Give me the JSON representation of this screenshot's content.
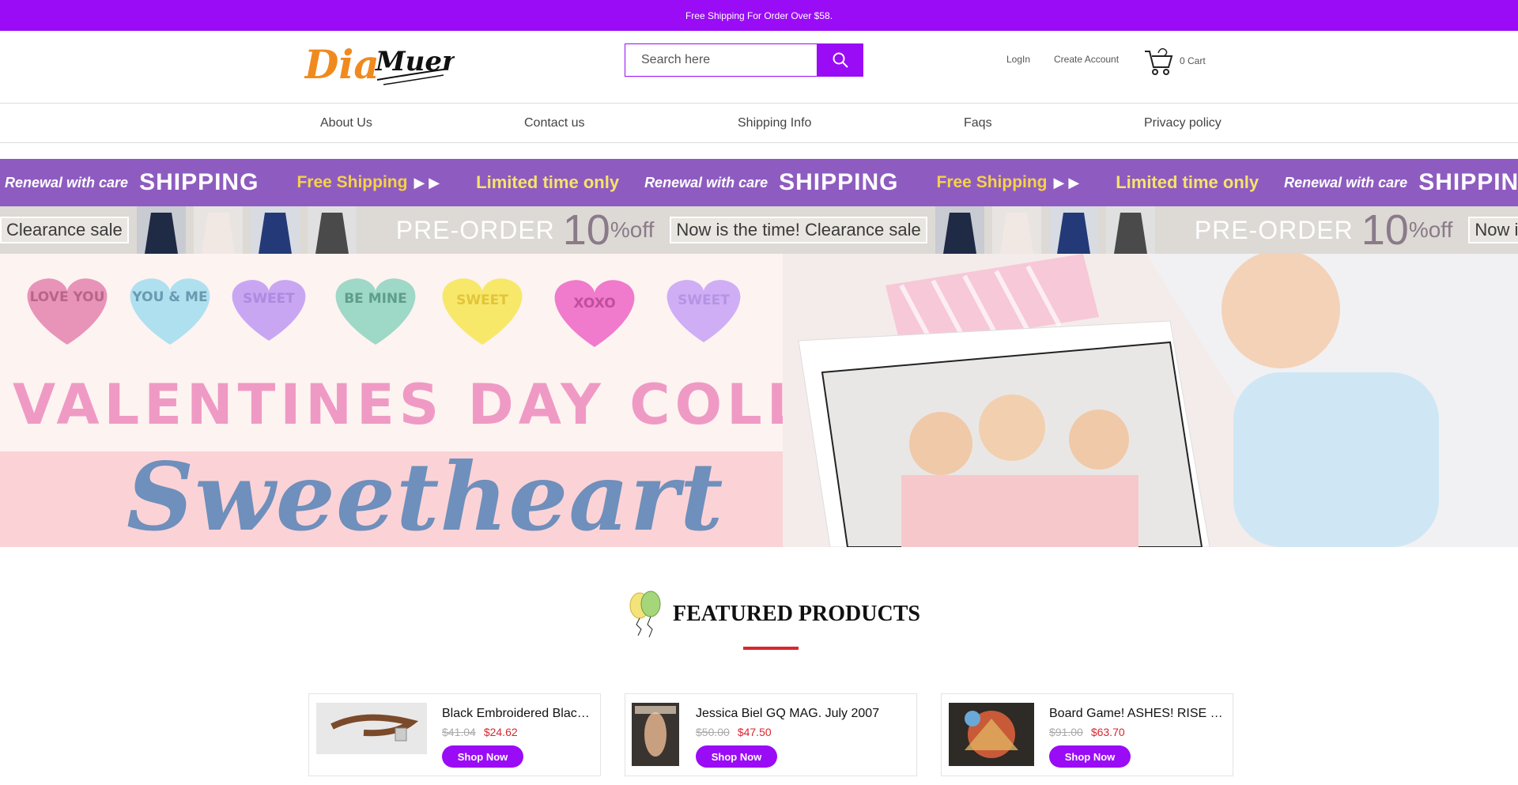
{
  "topbar": {
    "text": "Free Shipping For Order Over $58."
  },
  "header": {
    "logo_text_1": "Dia",
    "logo_text_2": "Muertos",
    "search_placeholder": "Search here",
    "login_label": "LogIn",
    "create_account_label": "Create Account",
    "cart_label": "0 Cart"
  },
  "nav": {
    "items": [
      {
        "label": "About Us"
      },
      {
        "label": "Contact us"
      },
      {
        "label": "Shipping Info"
      },
      {
        "label": "Faqs"
      },
      {
        "label": "Privacy policy"
      }
    ]
  },
  "promo_strip_1": {
    "renewal": "Renewal with care",
    "shipping": "SHIPPING",
    "free_shipping": "Free Shipping",
    "arrows": "▶ ▶",
    "limited": "Limited time only"
  },
  "promo_strip_2": {
    "clearance": "Clearance sale",
    "pre_order": "PRE-ORDER",
    "ten": "10",
    "percent_off": "%off",
    "now": "Now is the time! Clearance sale",
    "now_partial": "Now is the t"
  },
  "hero": {
    "hearts": [
      "LOVE YOU",
      "YOU & ME",
      "SWEET",
      "BE MINE",
      "SWEET",
      "XOXO",
      "SWEET"
    ],
    "title": "VALENTINES DAY COLLECTION",
    "script": "Sweetheart"
  },
  "featured": {
    "title": "FEATURED PRODUCTS",
    "products": [
      {
        "name": "Black Embroidered Black Leather Belt",
        "old_price": "$41.04",
        "new_price": "$24.62",
        "button": "Shop Now"
      },
      {
        "name": "Jessica Biel GQ MAG. July 2007",
        "old_price": "$50.00",
        "new_price": "$47.50",
        "button": "Shop Now"
      },
      {
        "name": "Board Game! ASHES! RISE OF THE PHOENIXBORN",
        "old_price": "$91.00",
        "new_price": "$63.70",
        "button": "Shop Now"
      }
    ]
  },
  "colors": {
    "brand_purple": "#9a0cf5",
    "accent_red": "#d9262e",
    "promo_purple": "#8e5cc0"
  }
}
